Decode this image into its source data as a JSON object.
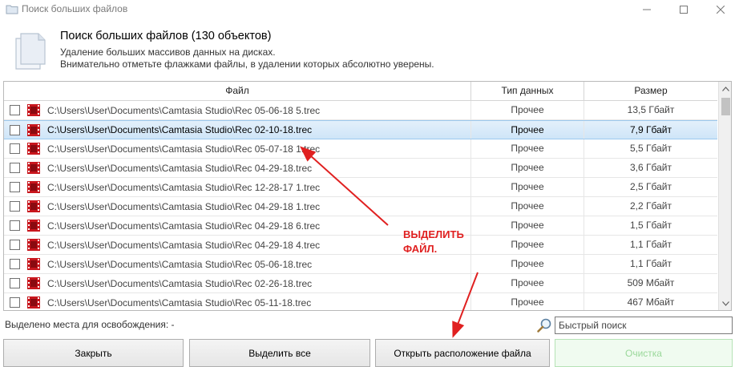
{
  "window": {
    "title": "Поиск больших файлов"
  },
  "header": {
    "title": "Поиск больших файлов (130 объектов)",
    "subtitle_1": "Удаление больших массивов данных на дисках.",
    "subtitle_2": "Внимательно отметьте флажками файлы, в удалении которых абсолютно уверены."
  },
  "table": {
    "columns": [
      "Файл",
      "Тип данных",
      "Размер"
    ],
    "rows": [
      {
        "path": "C:\\Users\\User\\Documents\\Camtasia Studio\\Rec 05-06-18 5.trec",
        "type": "Прочее",
        "size": "13,5 Гбайт",
        "selected": false,
        "checked": false
      },
      {
        "path": "C:\\Users\\User\\Documents\\Camtasia Studio\\Rec 02-10-18.trec",
        "type": "Прочее",
        "size": "7,9 Гбайт",
        "selected": true,
        "checked": false
      },
      {
        "path": "C:\\Users\\User\\Documents\\Camtasia Studio\\Rec 05-07-18 1.trec",
        "type": "Прочее",
        "size": "5,5 Гбайт",
        "selected": false,
        "checked": false
      },
      {
        "path": "C:\\Users\\User\\Documents\\Camtasia Studio\\Rec 04-29-18.trec",
        "type": "Прочее",
        "size": "3,6 Гбайт",
        "selected": false,
        "checked": false
      },
      {
        "path": "C:\\Users\\User\\Documents\\Camtasia Studio\\Rec 12-28-17 1.trec",
        "type": "Прочее",
        "size": "2,5 Гбайт",
        "selected": false,
        "checked": false
      },
      {
        "path": "C:\\Users\\User\\Documents\\Camtasia Studio\\Rec 04-29-18 1.trec",
        "type": "Прочее",
        "size": "2,2 Гбайт",
        "selected": false,
        "checked": false
      },
      {
        "path": "C:\\Users\\User\\Documents\\Camtasia Studio\\Rec 04-29-18 6.trec",
        "type": "Прочее",
        "size": "1,5 Гбайт",
        "selected": false,
        "checked": false
      },
      {
        "path": "C:\\Users\\User\\Documents\\Camtasia Studio\\Rec 04-29-18 4.trec",
        "type": "Прочее",
        "size": "1,1 Гбайт",
        "selected": false,
        "checked": false
      },
      {
        "path": "C:\\Users\\User\\Documents\\Camtasia Studio\\Rec 05-06-18.trec",
        "type": "Прочее",
        "size": "1,1 Гбайт",
        "selected": false,
        "checked": false
      },
      {
        "path": "C:\\Users\\User\\Documents\\Camtasia Studio\\Rec 02-26-18.trec",
        "type": "Прочее",
        "size": "509 Мбайт",
        "selected": false,
        "checked": false
      },
      {
        "path": "C:\\Users\\User\\Documents\\Camtasia Studio\\Rec 05-11-18.trec",
        "type": "Прочее",
        "size": "467 Мбайт",
        "selected": false,
        "checked": false
      }
    ]
  },
  "footer": {
    "freed_label": "Выделено места для освобождения: -",
    "search_placeholder": "Быстрый поиск",
    "buttons": {
      "close": "Закрыть",
      "select_all": "Выделить все",
      "open_location": "Открыть расположение файла",
      "clean": "Очистка"
    }
  },
  "annotation": {
    "line1": "ВЫДЕЛИТЬ",
    "line2": "ФАЙЛ.",
    "color": "#e02020"
  },
  "colors": {
    "selection_bg": "#cfe5f8",
    "clean_button_text": "#9ad89a",
    "file_icon": "#c8161d"
  },
  "icons": {
    "app": "folder-icon",
    "header": "documents-icon",
    "file": "video-file-icon",
    "search": "magnifier-icon"
  }
}
